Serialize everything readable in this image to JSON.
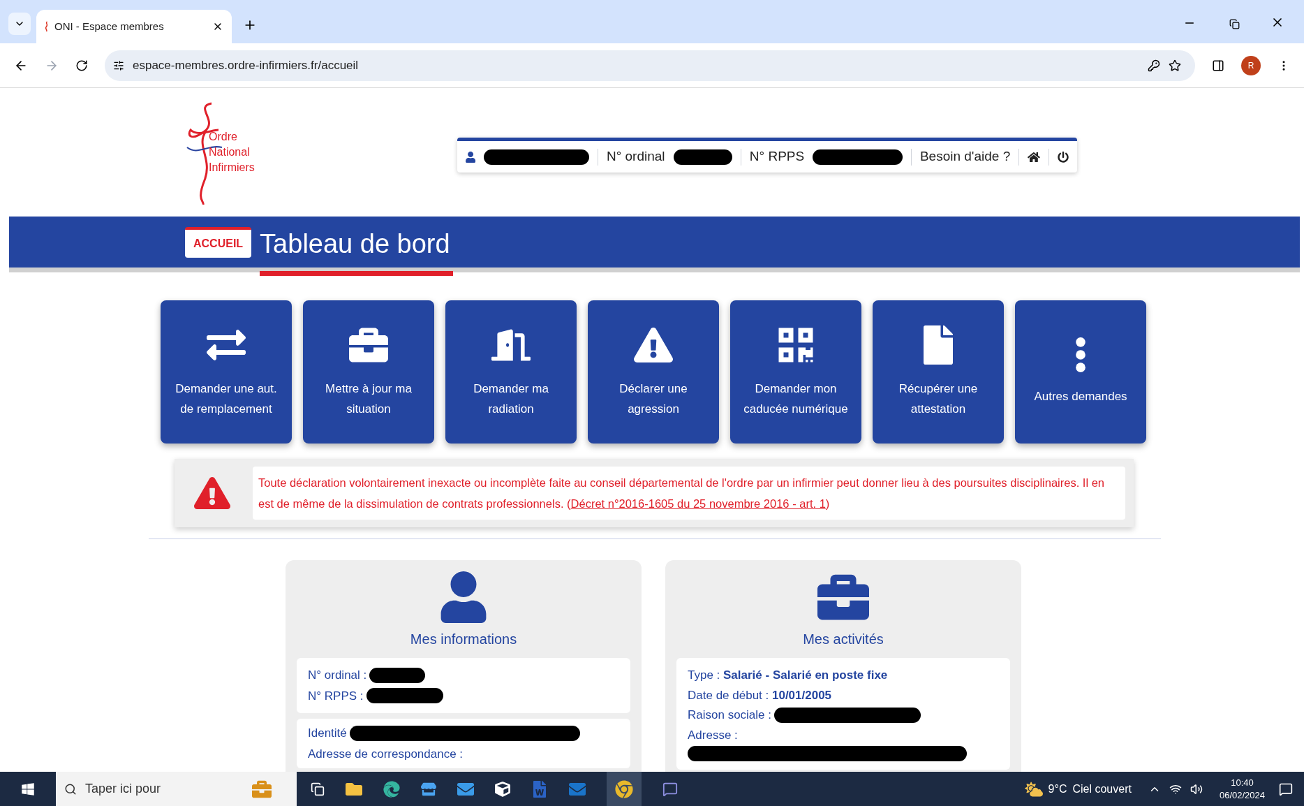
{
  "browser": {
    "tab_title": "ONI - Espace membres",
    "url": "espace-membres.ordre-infirmiers.fr/accueil",
    "profile_initial": "R"
  },
  "header": {
    "logo_lines": [
      "Ordre",
      "National",
      "Infirmiers"
    ],
    "user_bar": {
      "ordinal_label": "N° ordinal",
      "rpps_label": "N° RPPS",
      "help": "Besoin d'aide ?"
    }
  },
  "banner": {
    "badge": "ACCUEIL",
    "title": "Tableau de bord"
  },
  "tiles": [
    {
      "label": "Demander une aut. de remplacement"
    },
    {
      "label": "Mettre à jour ma situation"
    },
    {
      "label": "Demander ma radiation"
    },
    {
      "label": "Déclarer une agression"
    },
    {
      "label": "Demander mon caducée numérique"
    },
    {
      "label": "Récupérer une attestation"
    },
    {
      "label": "Autres demandes"
    }
  ],
  "warning": {
    "text": "Toute déclaration volontairement inexacte ou incomplète faite au conseil départemental de l'ordre par un infirmier peut donner lieu à des poursuites disciplinaires. Il en est de même de la dissimulation de contrats professionnels. (",
    "link": "Décret n°2016-1605 du 25 novembre 2016 - art. 1",
    "after": ")"
  },
  "info_card": {
    "title": "Mes informations",
    "ordinal_label": "N° ordinal :",
    "rpps_label": "N° RPPS :",
    "identity_label": "Identité",
    "address_label": "Adresse de correspondance :"
  },
  "activity_card": {
    "title": "Mes activités",
    "type_label": "Type : ",
    "type_value": "Salarié - Salarié en poste fixe",
    "start_label": "Date de début : ",
    "start_value": "10/01/2005",
    "company_label": "Raison sociale :",
    "address_label": "Adresse :"
  },
  "taskbar": {
    "search_placeholder": "Taper ici pour",
    "temperature": "9°C",
    "weather": "Ciel couvert",
    "time": "10:40",
    "date": "06/02/2024"
  }
}
